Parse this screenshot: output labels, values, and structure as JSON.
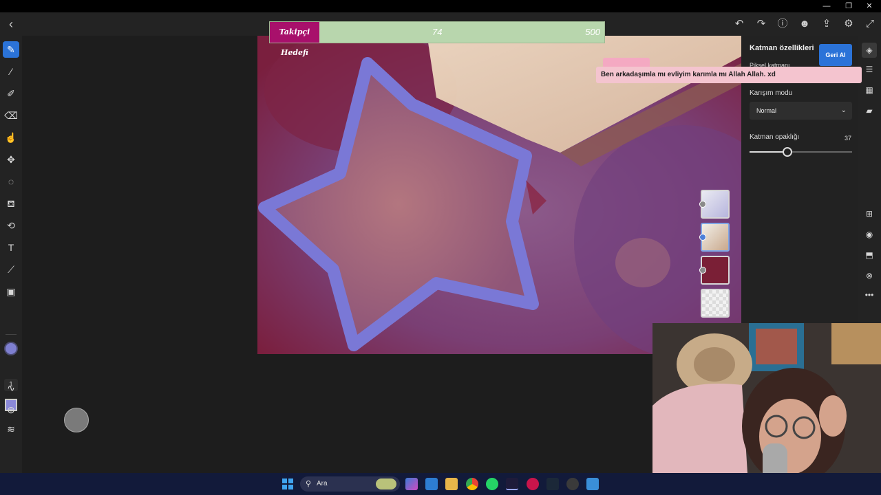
{
  "window": {
    "minimize": "—",
    "maximize": "❐",
    "close": "✕"
  },
  "appbar": {
    "back": "‹",
    "icons": [
      "undo-icon",
      "redo-icon",
      "help-icon",
      "user-icon",
      "share-icon",
      "settings-icon",
      "fullscreen-icon"
    ]
  },
  "goal": {
    "label": "Takipçi Hedefi",
    "current": "74",
    "target": "500"
  },
  "toolbar": {
    "brush_size": "1"
  },
  "panel": {
    "title": "Katman özellikleri",
    "undo_label": "Geri Al",
    "layer_kind": "Piksel katmanı",
    "blend_label": "Karışım modu",
    "blend_value": "Normal",
    "opacity_label": "Katman opaklığı",
    "opacity_value": "37",
    "opacity": 0.37
  },
  "chat": {
    "message": "Ben arkadaşımla mı evliyim karımla mı Allah Allah. xd"
  },
  "taskbar": {
    "search_placeholder": "Ara"
  },
  "colors": {
    "accent": "#2b73d8",
    "brush": "#7e7fd0",
    "canvas_bg": "#8a2f56",
    "goal_bar": "#b8d6ad",
    "goal_label": "#a8106b"
  }
}
